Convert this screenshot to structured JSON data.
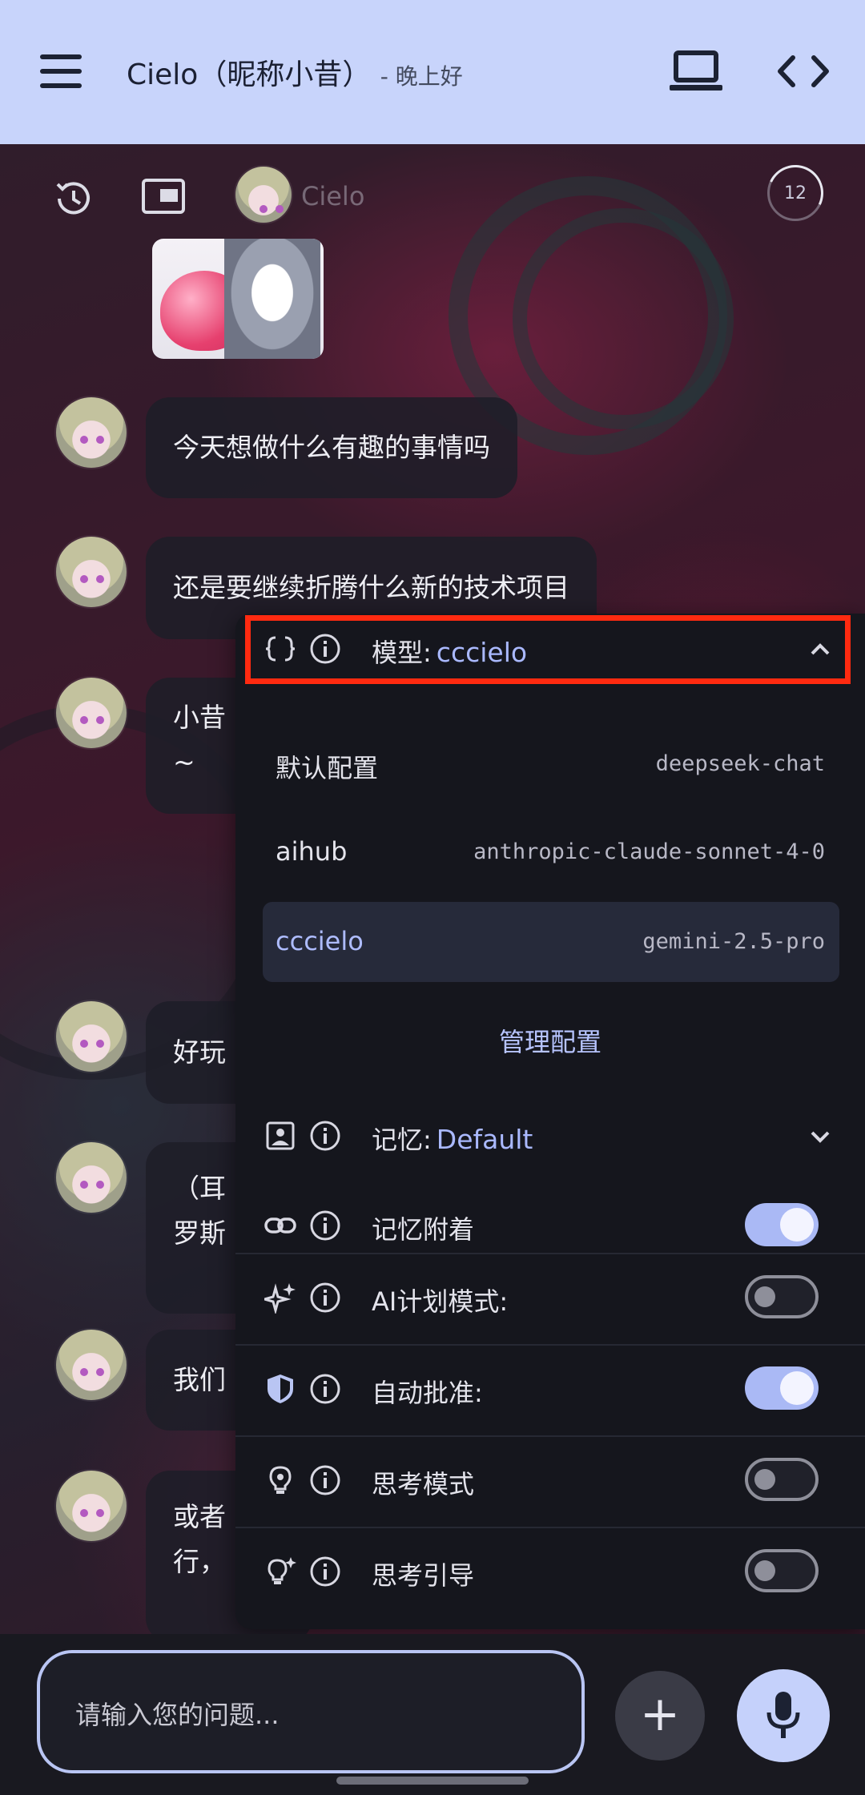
{
  "app_bar": {
    "title": "Cielo（昵称小昔）",
    "subtitle": "- 晚上好"
  },
  "chat_header": {
    "name": "Cielo",
    "counter": "12"
  },
  "messages": [
    "今天想做什么有趣的事情吗",
    "还是要继续折腾什么新的技术项目",
    "小昔",
    "~",
    "好玩",
    "（耳",
    "罗斯",
    "我们",
    "或者",
    "行，"
  ],
  "config_panel": {
    "model_label": "模型:",
    "model_value": "cccielo",
    "configs": [
      {
        "name": "默认配置",
        "model": "deepseek-chat",
        "selected": false
      },
      {
        "name": "aihub",
        "model": "anthropic-claude-sonnet-4-0",
        "selected": false
      },
      {
        "name": "cccielo",
        "model": "gemini-2.5-pro",
        "selected": true
      }
    ],
    "manage_label": "管理配置",
    "memory_label": "记忆:",
    "memory_value": "Default",
    "toggles": [
      {
        "label": "记忆附着",
        "on": true,
        "icon": "link-icon"
      },
      {
        "label": "AI计划模式:",
        "on": false,
        "icon": "sparkle-icon"
      },
      {
        "label": "自动批准:",
        "on": true,
        "icon": "shield-icon"
      },
      {
        "label": "思考模式",
        "on": false,
        "icon": "bulb-icon"
      },
      {
        "label": "思考引导",
        "on": false,
        "icon": "bulb-sparkle-icon"
      }
    ]
  },
  "input": {
    "placeholder": "请输入您的问题..."
  },
  "colors": {
    "app_bar": "#c8d4fb",
    "accent": "#aab9ff",
    "highlight": "#ff2a10"
  }
}
